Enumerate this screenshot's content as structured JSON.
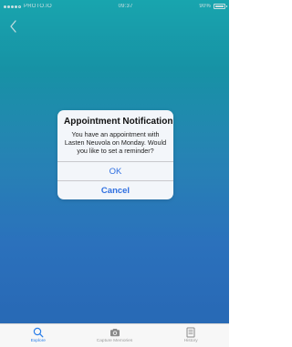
{
  "status_bar": {
    "carrier": "PROTO.IO",
    "time": "09:37",
    "battery": "90%"
  },
  "nav": {
    "back_icon": "chevron-left-icon"
  },
  "alert": {
    "title": "Appointment Notification",
    "message": "You have an appointment with Lasten Neuvola on Monday. Would you like to set a reminder?",
    "ok_label": "OK",
    "cancel_label": "Cancel",
    "button_color": "#2f6fe0"
  },
  "tab_bar": {
    "tabs": [
      {
        "label": "Explore",
        "icon": "search-icon",
        "active": true
      },
      {
        "label": "Capture Memories",
        "icon": "camera-icon",
        "active": false
      },
      {
        "label": "History",
        "icon": "history-list-icon",
        "active": false
      }
    ],
    "active_color": "#2a7ee8",
    "inactive_color": "#9a9a9a"
  },
  "colors": {
    "background_top": "#1bb3bd",
    "background_bottom": "#2b70c3"
  }
}
